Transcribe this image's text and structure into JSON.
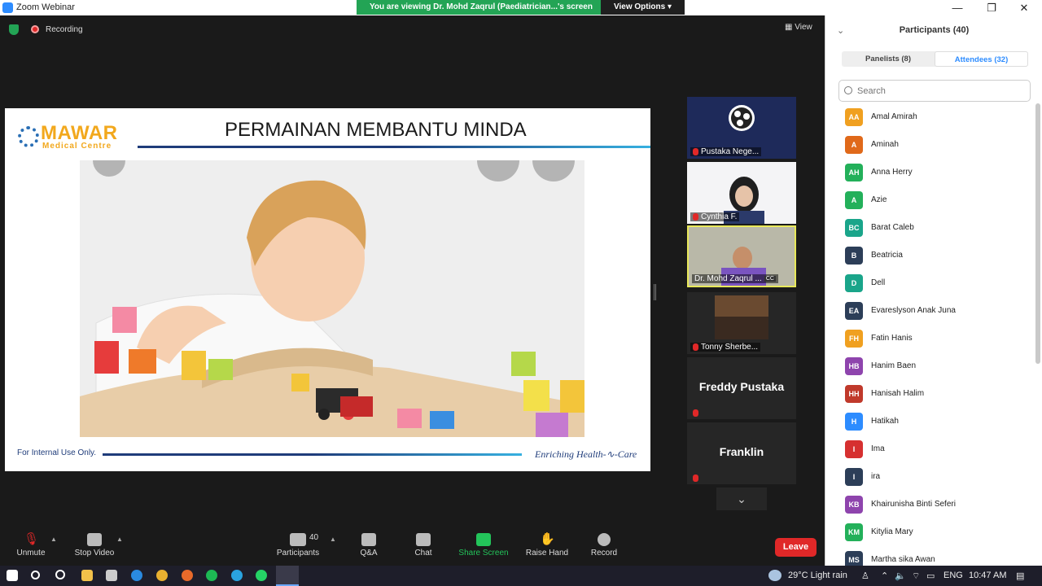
{
  "window": {
    "title": "Zoom Webinar",
    "minimize": "—",
    "restore": "❐",
    "close": "✕"
  },
  "share_banner": {
    "message": "You are viewing Dr. Mohd Zaqrul (Paediatrician...'s screen",
    "view_options": "View Options ▾"
  },
  "meeting": {
    "recording": "Recording",
    "view": "View"
  },
  "slide": {
    "logo_name": "MAWAR",
    "logo_sub": "Medical Centre",
    "title": "PERMAINAN MEMBANTU MINDA",
    "footer_note": "For Internal Use Only.",
    "footer_tag": "Enriching Health-∿-Care"
  },
  "videos": [
    {
      "name": "Pustaka Nege..."
    },
    {
      "name": "Cynthia F."
    },
    {
      "name": "Dr. Mohd Zaqrul ...",
      "badge": "CC"
    },
    {
      "name": "Tonny Sherbe..."
    },
    {
      "name": "Freddy Pustaka"
    },
    {
      "name": "Franklin"
    }
  ],
  "toolbar": {
    "unmute": "Unmute",
    "stop_video": "Stop Video",
    "participants": "Participants",
    "participants_count": "40",
    "qa": "Q&A",
    "chat": "Chat",
    "share_screen": "Share Screen",
    "raise_hand": "Raise Hand",
    "record": "Record",
    "leave": "Leave"
  },
  "panel": {
    "title": "Participants (40)",
    "tab_panelists": "Panelists (8)",
    "tab_attendees": "Attendees (32)",
    "search_placeholder": "Search",
    "attendees": [
      {
        "initials": "AA",
        "name": "Amal Amirah",
        "color": "#f0a020"
      },
      {
        "initials": "A",
        "name": "Aminah",
        "color": "#e0691a"
      },
      {
        "initials": "AH",
        "name": "Anna Herry",
        "color": "#23b05a"
      },
      {
        "initials": "A",
        "name": "Azie",
        "color": "#23b05a"
      },
      {
        "initials": "BC",
        "name": "Barat Caleb",
        "color": "#1aa58a"
      },
      {
        "initials": "B",
        "name": "Beatricia",
        "color": "#2c3e58"
      },
      {
        "initials": "D",
        "name": "Dell",
        "color": "#1aa58a"
      },
      {
        "initials": "EA",
        "name": "Evareslyson Anak Juna",
        "color": "#2c3e58"
      },
      {
        "initials": "FH",
        "name": "Fatin Hanis",
        "color": "#f0a020"
      },
      {
        "initials": "HB",
        "name": "Hanim Baen",
        "color": "#8e44ad"
      },
      {
        "initials": "HH",
        "name": "Hanisah Halim",
        "color": "#c0392b"
      },
      {
        "initials": "H",
        "name": "Hatikah",
        "color": "#2d8cff"
      },
      {
        "initials": "I",
        "name": "Ima",
        "color": "#d63030"
      },
      {
        "initials": "I",
        "name": "ira",
        "color": "#2c3e58"
      },
      {
        "initials": "KB",
        "name": "Khairunisha Binti Seferi",
        "color": "#8e44ad"
      },
      {
        "initials": "KM",
        "name": "Kitylia Mary",
        "color": "#23b05a"
      },
      {
        "initials": "MS",
        "name": "Martha sika Awan",
        "color": "#2c3e58"
      }
    ]
  },
  "taskbar": {
    "weather": "29°C  Light rain",
    "lang": "ENG",
    "time": "10:47 AM"
  }
}
